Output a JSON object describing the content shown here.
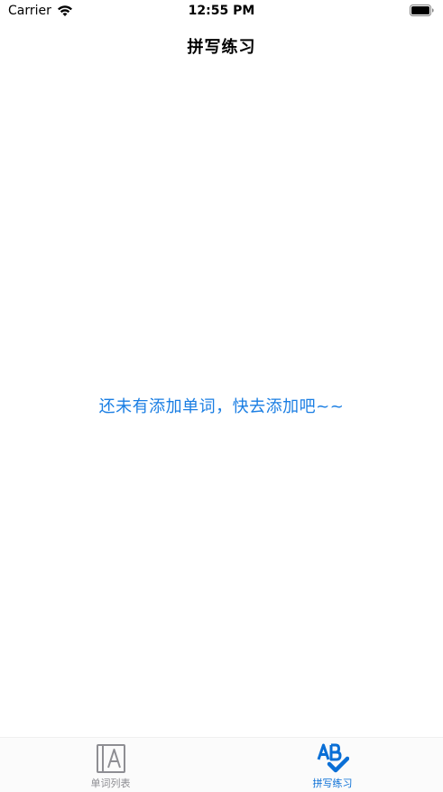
{
  "status_bar": {
    "carrier": "Carrier",
    "time": "12:55 PM"
  },
  "nav": {
    "title": "拼写练习"
  },
  "empty_state": {
    "message": "还未有添加单词，快去添加吧~~"
  },
  "tab_bar": {
    "tabs": [
      {
        "label": "单词列表",
        "icon": "word-list-icon",
        "active": false
      },
      {
        "label": "拼写练习",
        "icon": "spelling-check-icon",
        "active": true
      }
    ],
    "active_color": "#0a6fd6",
    "inactive_color": "#8e8e93"
  },
  "colors": {
    "accent": "#1a7ee3"
  }
}
